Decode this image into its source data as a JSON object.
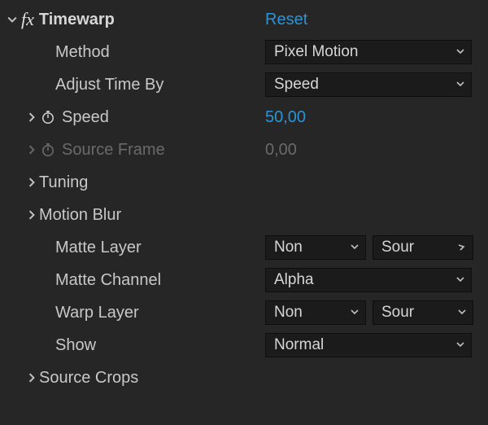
{
  "effect": {
    "name": "Timewarp",
    "reset": "Reset"
  },
  "props": {
    "method": {
      "label": "Method",
      "value": "Pixel Motion"
    },
    "adjustTimeBy": {
      "label": "Adjust Time By",
      "value": "Speed"
    },
    "speed": {
      "label": "Speed",
      "value": "50,00"
    },
    "sourceFrame": {
      "label": "Source Frame",
      "value": "0,00"
    },
    "tuning": {
      "label": "Tuning"
    },
    "motionBlur": {
      "label": "Motion Blur"
    },
    "matteLayer": {
      "label": "Matte Layer",
      "value1": "Non",
      "value2": "Sour"
    },
    "matteChannel": {
      "label": "Matte Channel",
      "value": "Alpha"
    },
    "warpLayer": {
      "label": "Warp Layer",
      "value1": "Non",
      "value2": "Sour"
    },
    "show": {
      "label": "Show",
      "value": "Normal"
    },
    "sourceCrops": {
      "label": "Source Crops"
    }
  }
}
